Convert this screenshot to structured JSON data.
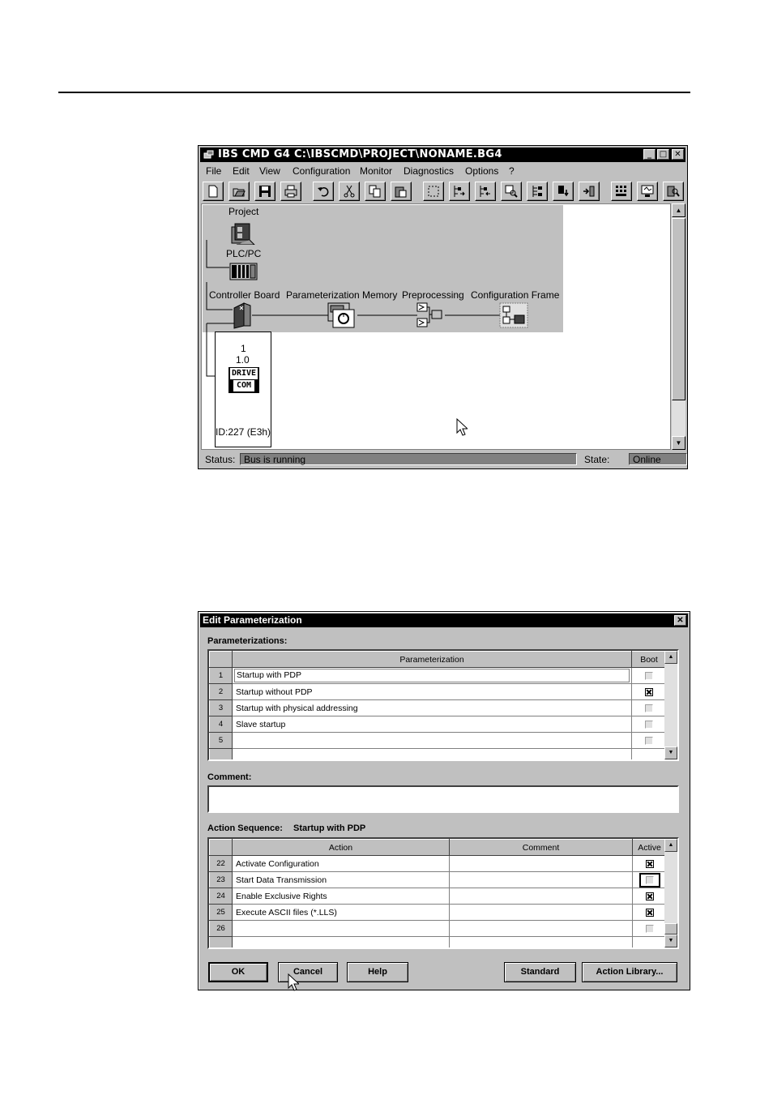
{
  "window": {
    "title": "IBS CMD G4 C:\\IBSCMD\\PROJECT\\NONAME.BG4",
    "menu": [
      "File",
      "Edit",
      "View",
      "Configuration",
      "Monitor",
      "Diagnostics",
      "Options",
      "?"
    ],
    "tree": {
      "project": "Project",
      "plc": "PLC/PC",
      "controller": "Controller Board",
      "param_memory": "Parameterization Memory",
      "preprocessing": "Preprocessing",
      "config_frame": "Configuration Frame"
    },
    "device": {
      "number": "1",
      "address": "1.0",
      "logo_top": "DRIVE",
      "logo_bottom": "COM",
      "id": "ID:227 (E3h)"
    },
    "status": {
      "status_label": "Status:",
      "status_value": "Bus is running",
      "state_label": "State:",
      "state_value": "Online"
    }
  },
  "dialog": {
    "title": "Edit Parameterization",
    "params_label": "Parameterizations:",
    "params_header": {
      "name": "Parameterization",
      "boot": "Boot"
    },
    "params": [
      {
        "n": "1",
        "name": "Startup with PDP",
        "boot": false
      },
      {
        "n": "2",
        "name": "Startup without PDP",
        "boot": true
      },
      {
        "n": "3",
        "name": "Startup with physical addressing",
        "boot": false
      },
      {
        "n": "4",
        "name": "Slave startup",
        "boot": false
      },
      {
        "n": "5",
        "name": "",
        "boot": false
      }
    ],
    "comment_label": "Comment:",
    "sequence_label": "Action Sequence:",
    "sequence_name": "Startup with PDP",
    "actions_header": {
      "action": "Action",
      "comment": "Comment",
      "active": "Active"
    },
    "actions": [
      {
        "n": "22",
        "action": "Activate Configuration",
        "comment": "",
        "active": true
      },
      {
        "n": "23",
        "action": "Start Data Transmission",
        "comment": "",
        "active": false
      },
      {
        "n": "24",
        "action": "Enable Exclusive Rights",
        "comment": "",
        "active": true
      },
      {
        "n": "25",
        "action": "Execute ASCII files (*.LLS)",
        "comment": "",
        "active": true
      },
      {
        "n": "26",
        "action": "",
        "comment": "",
        "active": false
      }
    ],
    "buttons": {
      "ok": "OK",
      "cancel": "Cancel",
      "help": "Help",
      "standard": "Standard",
      "library": "Action Library..."
    }
  }
}
